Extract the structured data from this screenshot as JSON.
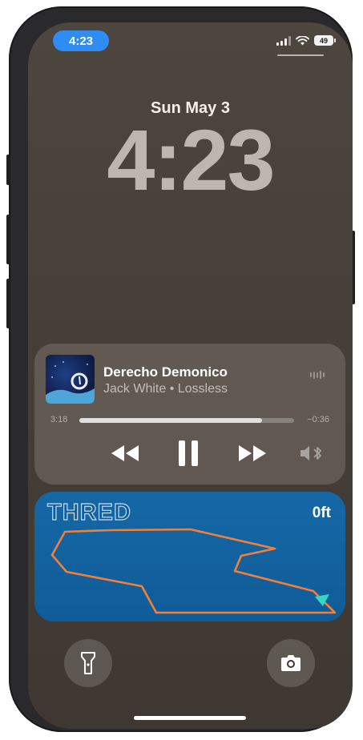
{
  "status_bar": {
    "time": "4:23",
    "battery": "49"
  },
  "lock_screen": {
    "date": "Sun May 3",
    "time": "4:23"
  },
  "now_playing": {
    "title": "Derecho Demonico",
    "subtitle": "Jack White • Lossless",
    "elapsed": "3:18",
    "remaining": "−0:36",
    "progress": 0.85
  },
  "game_widget": {
    "title": "THRED",
    "altitude": "0ft",
    "route_color": "#f0803a",
    "marker_color": "#35d6c2"
  },
  "icons": {
    "flashlight": "flashlight-icon",
    "camera": "camera-icon",
    "play_pause": "pause-icon",
    "rewind": "rewind-icon",
    "forward": "fast-forward-icon",
    "output": "speaker-bluetooth-icon"
  },
  "colors": {
    "time_pill": "#2f8cf5",
    "wallpaper": "#463f38"
  }
}
